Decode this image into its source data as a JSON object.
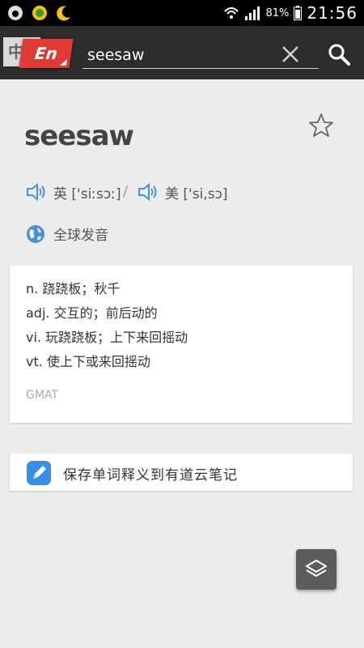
{
  "status_bar": {
    "battery_percent": "81%",
    "time": "21:56"
  },
  "search_bar": {
    "lang_zh_label": "中",
    "lang_en_label": "En",
    "query": "seesaw"
  },
  "entry": {
    "word": "seesaw",
    "favorite": false,
    "uk_pron": "英 ['siːsɔː]",
    "separator": "/",
    "us_pron": "美 ['si,sɔ]",
    "global_pron_label": "全球发音"
  },
  "definitions": [
    "n. 跷跷板；秋千",
    "adj. 交互的；前后动的",
    "vi. 玩跷跷板；上下来回摇动",
    "vt. 使上下或来回摇动"
  ],
  "tag": "GMAT",
  "save_note_label": "保存单词释义到有道云笔记",
  "colors": {
    "accent_red": "#e03a35",
    "icon_blue": "#4a90d9",
    "note_blue": "#3a8ee6"
  }
}
